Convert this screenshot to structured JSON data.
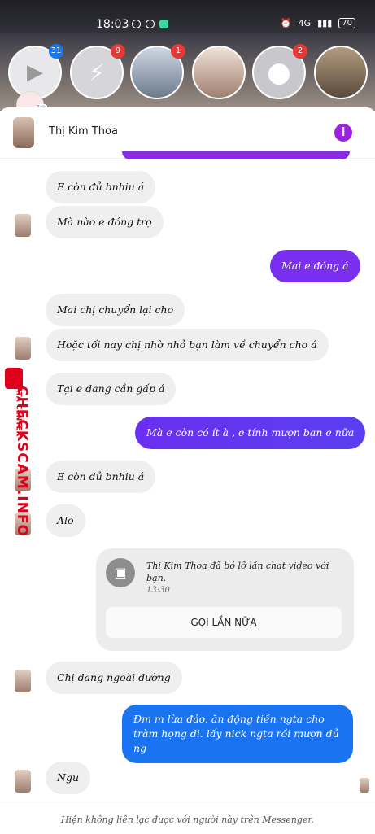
{
  "status_bar": {
    "time": "18:03",
    "network": "4G",
    "battery": "70"
  },
  "chat_heads": {
    "badges": [
      "31",
      "9",
      "1",
      "2"
    ]
  },
  "header": {
    "contact_name": "Thị Kim Thoa",
    "info_icon": "i"
  },
  "messages": [
    {
      "dir": "in",
      "text": "E còn đủ bnhiu á"
    },
    {
      "dir": "in",
      "text": "Mà nào e đóng trọ"
    },
    {
      "dir": "out",
      "text": "Mai e đóng á"
    },
    {
      "dir": "in",
      "text": "Mai chị chuyển lại cho"
    },
    {
      "dir": "in",
      "text": "Hoặc tối nay chị nhờ nhỏ bạn làm về chuyển cho á"
    },
    {
      "dir": "in",
      "text": "Tại e đang cần gấp á"
    },
    {
      "dir": "out",
      "text": "Mà e còn có ít à , e tính mượn bạn e nữa"
    },
    {
      "dir": "in",
      "text": "E còn đủ bnhiu á"
    },
    {
      "dir": "in",
      "text": "Alo"
    },
    {
      "dir": "in",
      "text": "Chị đang ngoài đường"
    },
    {
      "dir": "out",
      "text": "Đm m lừa đảo. ăn động tiền ngta cho tràm họng đi. lấy nick ngta rồi mượn đủ ng"
    },
    {
      "dir": "in",
      "text": "Ngu"
    }
  ],
  "missed_call": {
    "text": "Thị Kim Thoa đã bỏ lỡ lần chat video với bạn.",
    "time": "13:30",
    "button": "GỌI LẦN NỮA"
  },
  "footer": {
    "notice": "Hiện không liên lạc được với người này trên Messenger."
  },
  "watermark": {
    "brand": "CHECKSCAM.INFO",
    "sub": "DATA CENTER"
  },
  "colors": {
    "outgoing_start": "#7a2ff0",
    "outgoing_end": "#3d5bf0",
    "last_outgoing": "#1a73f0",
    "info": "#9b22e0"
  }
}
